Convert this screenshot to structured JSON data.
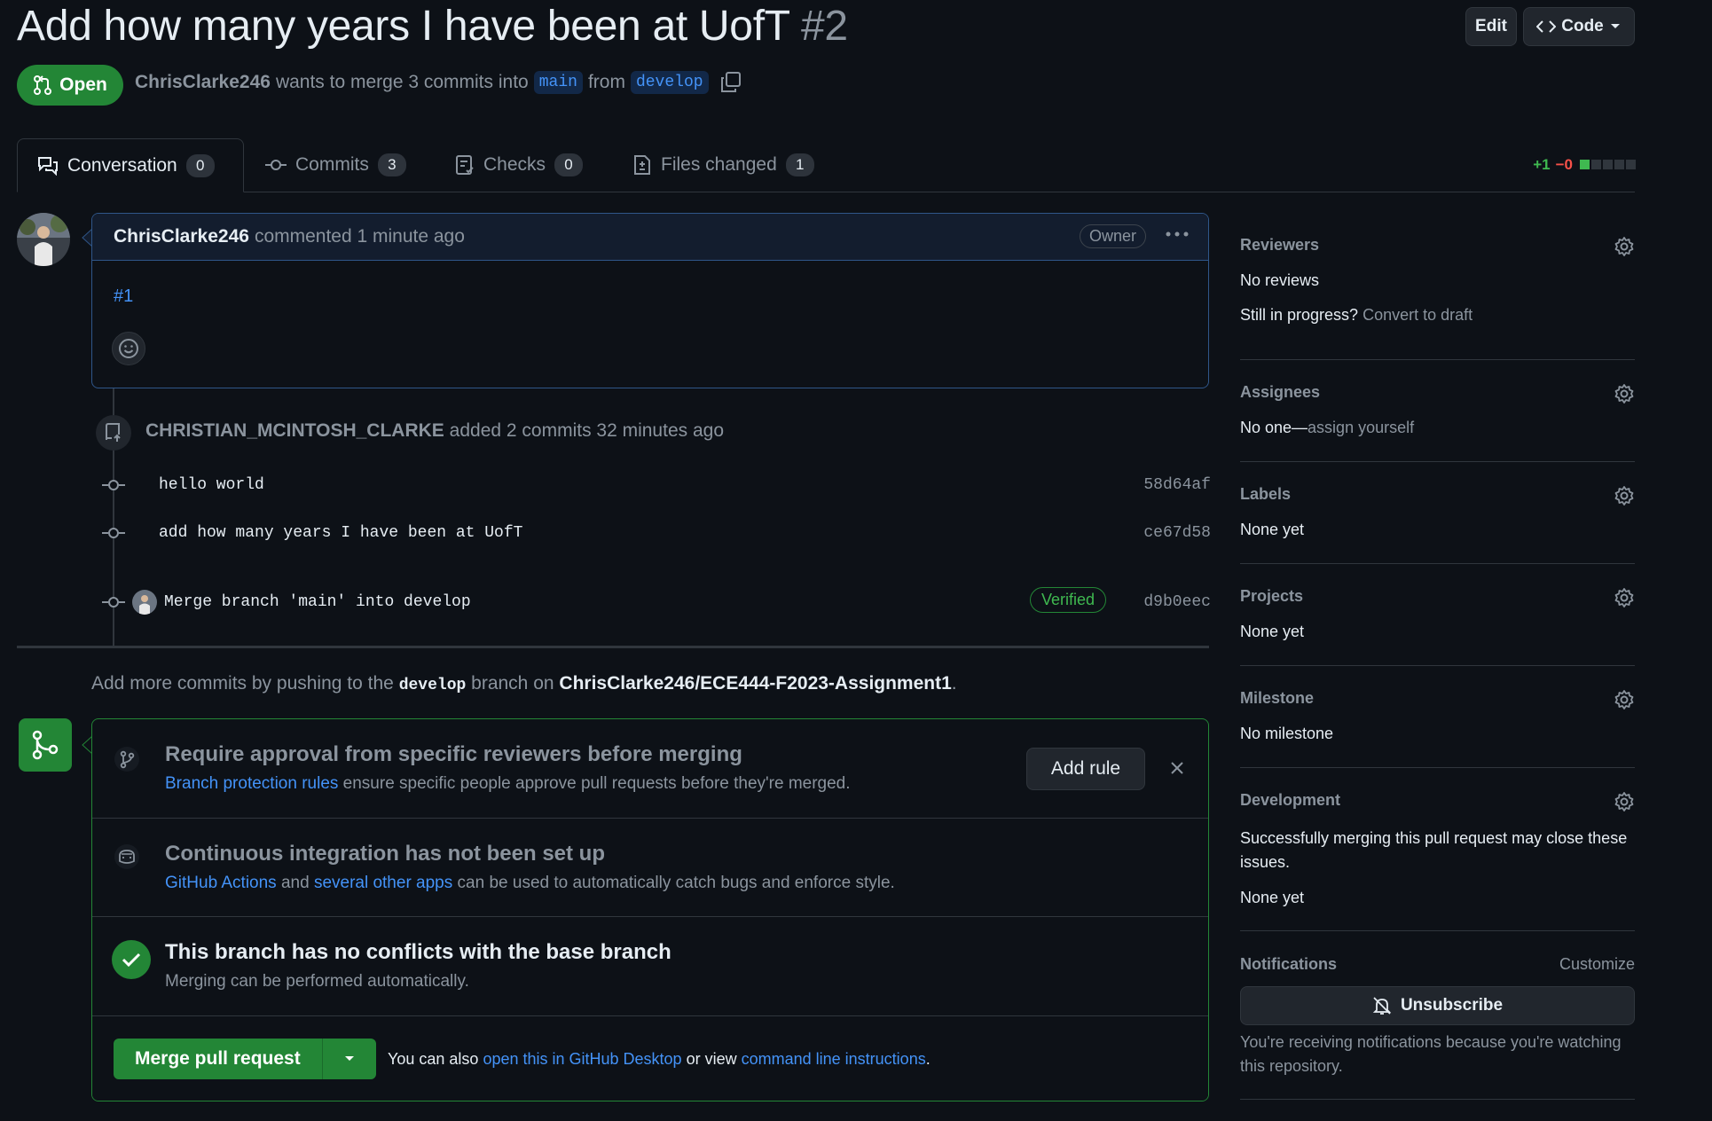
{
  "pr": {
    "title": "Add how many years I have been at UofT",
    "number": "#2",
    "state": "Open",
    "author": "ChrisClarke246",
    "merge_text": "wants to merge 3 commits into",
    "base": "main",
    "from_text": "from",
    "head": "develop"
  },
  "header_actions": {
    "edit": "Edit",
    "code": "Code"
  },
  "tabs": [
    {
      "label": "Conversation",
      "count": "0"
    },
    {
      "label": "Commits",
      "count": "3"
    },
    {
      "label": "Checks",
      "count": "0"
    },
    {
      "label": "Files changed",
      "count": "1"
    }
  ],
  "diffstat": {
    "added": "+1",
    "removed": "−0"
  },
  "comment": {
    "author": "ChrisClarke246",
    "action": "commented 1 minute ago",
    "badge": "Owner",
    "body_link": "#1"
  },
  "timeline": {
    "actor": "CHRISTIAN_MCINTOSH_CLARKE",
    "event": "added 2 commits 32 minutes ago",
    "commits": [
      {
        "message": "hello world",
        "sha": "58d64af"
      },
      {
        "message": "add how many years I have been at UofT",
        "sha": "ce67d58"
      },
      {
        "message": "Merge branch 'main' into develop",
        "sha": "d9b0eec",
        "badge": "Verified"
      }
    ]
  },
  "push_hint": {
    "prefix": "Add more commits by pushing to the",
    "branch": "develop",
    "middle": "branch on",
    "repo": "ChrisClarke246/ECE444-F2023-Assignment1",
    "suffix": "."
  },
  "mergebox": {
    "protect": {
      "title": "Require approval from specific reviewers before merging",
      "link": "Branch protection rules",
      "text": "ensure specific people approve pull requests before they're merged.",
      "button": "Add rule"
    },
    "ci": {
      "title": "Continuous integration has not been set up",
      "link1": "GitHub Actions",
      "and": "and",
      "link2": "several other apps",
      "text": "can be used to automatically catch bugs and enforce style."
    },
    "conflicts": {
      "title": "This branch has no conflicts with the base branch",
      "text": "Merging can be performed automatically."
    },
    "merge": {
      "button": "Merge pull request",
      "also": "You can also",
      "link1": "open this in GitHub Desktop",
      "or": "or view",
      "link2": "command line instructions",
      "end": "."
    }
  },
  "sidebar": {
    "reviewers": {
      "label": "Reviewers",
      "value": "No reviews",
      "progress_q": "Still in progress?",
      "draft_link": "Convert to draft"
    },
    "assignees": {
      "label": "Assignees",
      "value": "No one—",
      "assign_link": "assign yourself"
    },
    "labels": {
      "label": "Labels",
      "value": "None yet"
    },
    "projects": {
      "label": "Projects",
      "value": "None yet"
    },
    "milestone": {
      "label": "Milestone",
      "value": "No milestone"
    },
    "development": {
      "label": "Development",
      "text": "Successfully merging this pull request may close these issues.",
      "value": "None yet"
    },
    "notifications": {
      "label": "Notifications",
      "customize": "Customize",
      "button": "Unsubscribe",
      "reason": "You're receiving notifications because you're watching this repository."
    }
  },
  "colors": {
    "accent": "#4493f8",
    "success": "#238636",
    "danger": "#f85149",
    "bg": "#0d1117"
  }
}
